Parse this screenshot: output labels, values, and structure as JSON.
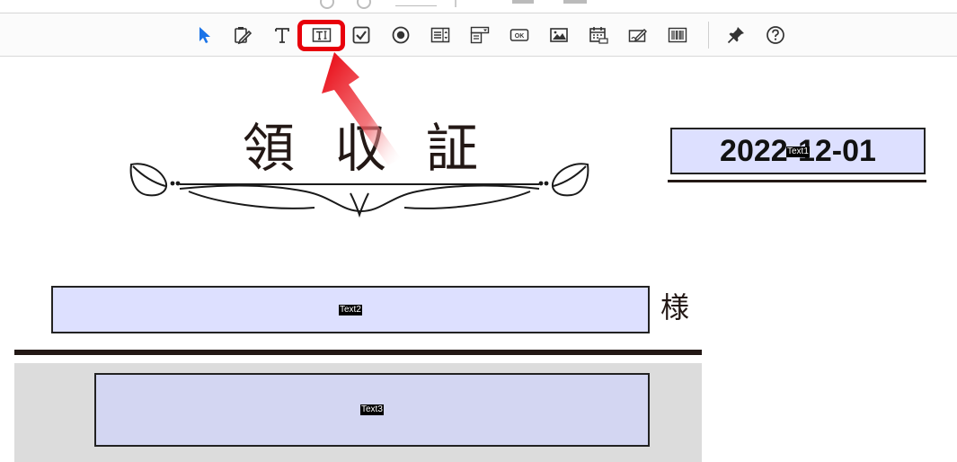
{
  "toolbar": {
    "tools": [
      {
        "icon": "select-arrow-icon"
      },
      {
        "icon": "edit-form-icon"
      },
      {
        "icon": "text-icon"
      },
      {
        "icon": "text-field-icon",
        "highlighted": true
      },
      {
        "icon": "checkbox-icon"
      },
      {
        "icon": "radio-button-icon"
      },
      {
        "icon": "list-box-icon"
      },
      {
        "icon": "dropdown-icon"
      },
      {
        "icon": "ok-button-icon",
        "label": "OK"
      },
      {
        "icon": "image-icon"
      },
      {
        "icon": "date-field-icon"
      },
      {
        "icon": "signature-icon"
      },
      {
        "icon": "barcode-icon"
      },
      {
        "icon": "pin-icon"
      },
      {
        "icon": "help-icon"
      }
    ],
    "accent_color": "#1a73e8",
    "highlight_color": "#e8000b"
  },
  "document": {
    "title": "領収証",
    "date_field": {
      "value": "2022-12-01",
      "tag": "Text1"
    },
    "name_field": {
      "tag": "Text2"
    },
    "honorific": "様",
    "amount_field": {
      "tag": "Text3"
    },
    "field_color": "#dde0ff"
  }
}
